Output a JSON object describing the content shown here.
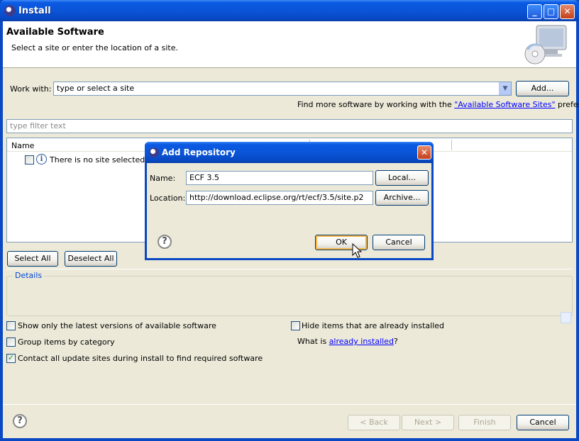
{
  "window": {
    "title": "Install",
    "min": "_",
    "max": "□",
    "close": "✕"
  },
  "header": {
    "title": "Available Software",
    "description": "Select a site or enter the location of a site."
  },
  "work_with": {
    "label": "Work with:",
    "value": "type or select a site",
    "dropdown_arrow": "▼",
    "add_button": "Add..."
  },
  "find_more": {
    "prefix": "Find more software by working with the ",
    "link": "\"Available Software Sites\"",
    "suffix": " preferences."
  },
  "filter": {
    "placeholder": "type filter text"
  },
  "tree": {
    "column_name": "Name",
    "empty_message": "There is no site selected."
  },
  "buttons": {
    "select_all": "Select All",
    "deselect_all": "Deselect All"
  },
  "details": {
    "label": "Details"
  },
  "options": {
    "latest_versions": {
      "label": "Show only the latest versions of available software",
      "checked": false
    },
    "group_by_category": {
      "label": "Group items by category",
      "checked": false
    },
    "contact_sites": {
      "label": "Contact all update sites during install to find required software",
      "checked": true
    },
    "hide_installed": {
      "label": "Hide items that are already installed",
      "checked": false
    },
    "what_is_prefix": "What is ",
    "what_is_link": "already installed",
    "what_is_suffix": "?"
  },
  "footer": {
    "help": "?",
    "back": "< Back",
    "next": "Next >",
    "finish": "Finish",
    "cancel": "Cancel"
  },
  "dialog": {
    "title": "Add Repository",
    "close": "✕",
    "name_label": "Name:",
    "name_value": "ECF 3.5",
    "location_label": "Location:",
    "location_value": "http://download.eclipse.org/rt/ecf/3.5/site.p2",
    "local_button": "Local...",
    "archive_button": "Archive...",
    "help": "?",
    "ok_button": "OK",
    "cancel_button": "Cancel"
  }
}
